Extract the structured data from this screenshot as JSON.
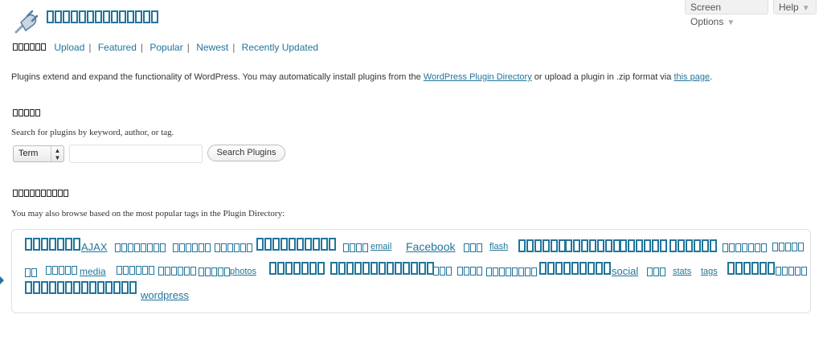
{
  "header": {
    "screen_options_label": "Screen Options",
    "help_label": "Help"
  },
  "subnav": {
    "items": [
      "Upload",
      "Featured",
      "Popular",
      "Newest",
      "Recently Updated"
    ]
  },
  "intro": {
    "text_before": "Plugins extend and expand the functionality of WordPress. You may automatically install plugins from the ",
    "directory_link": "WordPress Plugin Directory",
    "text_middle": " or upload a plugin in .zip format via ",
    "this_page_link": "this page",
    "text_after": "."
  },
  "search": {
    "description": "Search for plugins by keyword, author, or tag.",
    "type_selected": "Term",
    "input_value": "",
    "button_label": "Search Plugins"
  },
  "popular_tags": {
    "description": "You may also browse based on the most popular tags in the Plugin Directory:",
    "visible_tags": {
      "ajax": "AJAX",
      "email": "email",
      "facebook": "Facebook",
      "flash": "flash",
      "media": "media",
      "photos": "photos",
      "social": "social",
      "stats": "stats",
      "tags": "tags",
      "wordpress": "wordpress"
    }
  },
  "colors": {
    "link": "#21759b",
    "text": "#333333",
    "border": "#dfdfdf"
  },
  "icons": {
    "plugin": "plugin-plug-icon",
    "dropdown": "select-updown-icon",
    "menu_arrow": "triangle-down-icon"
  }
}
